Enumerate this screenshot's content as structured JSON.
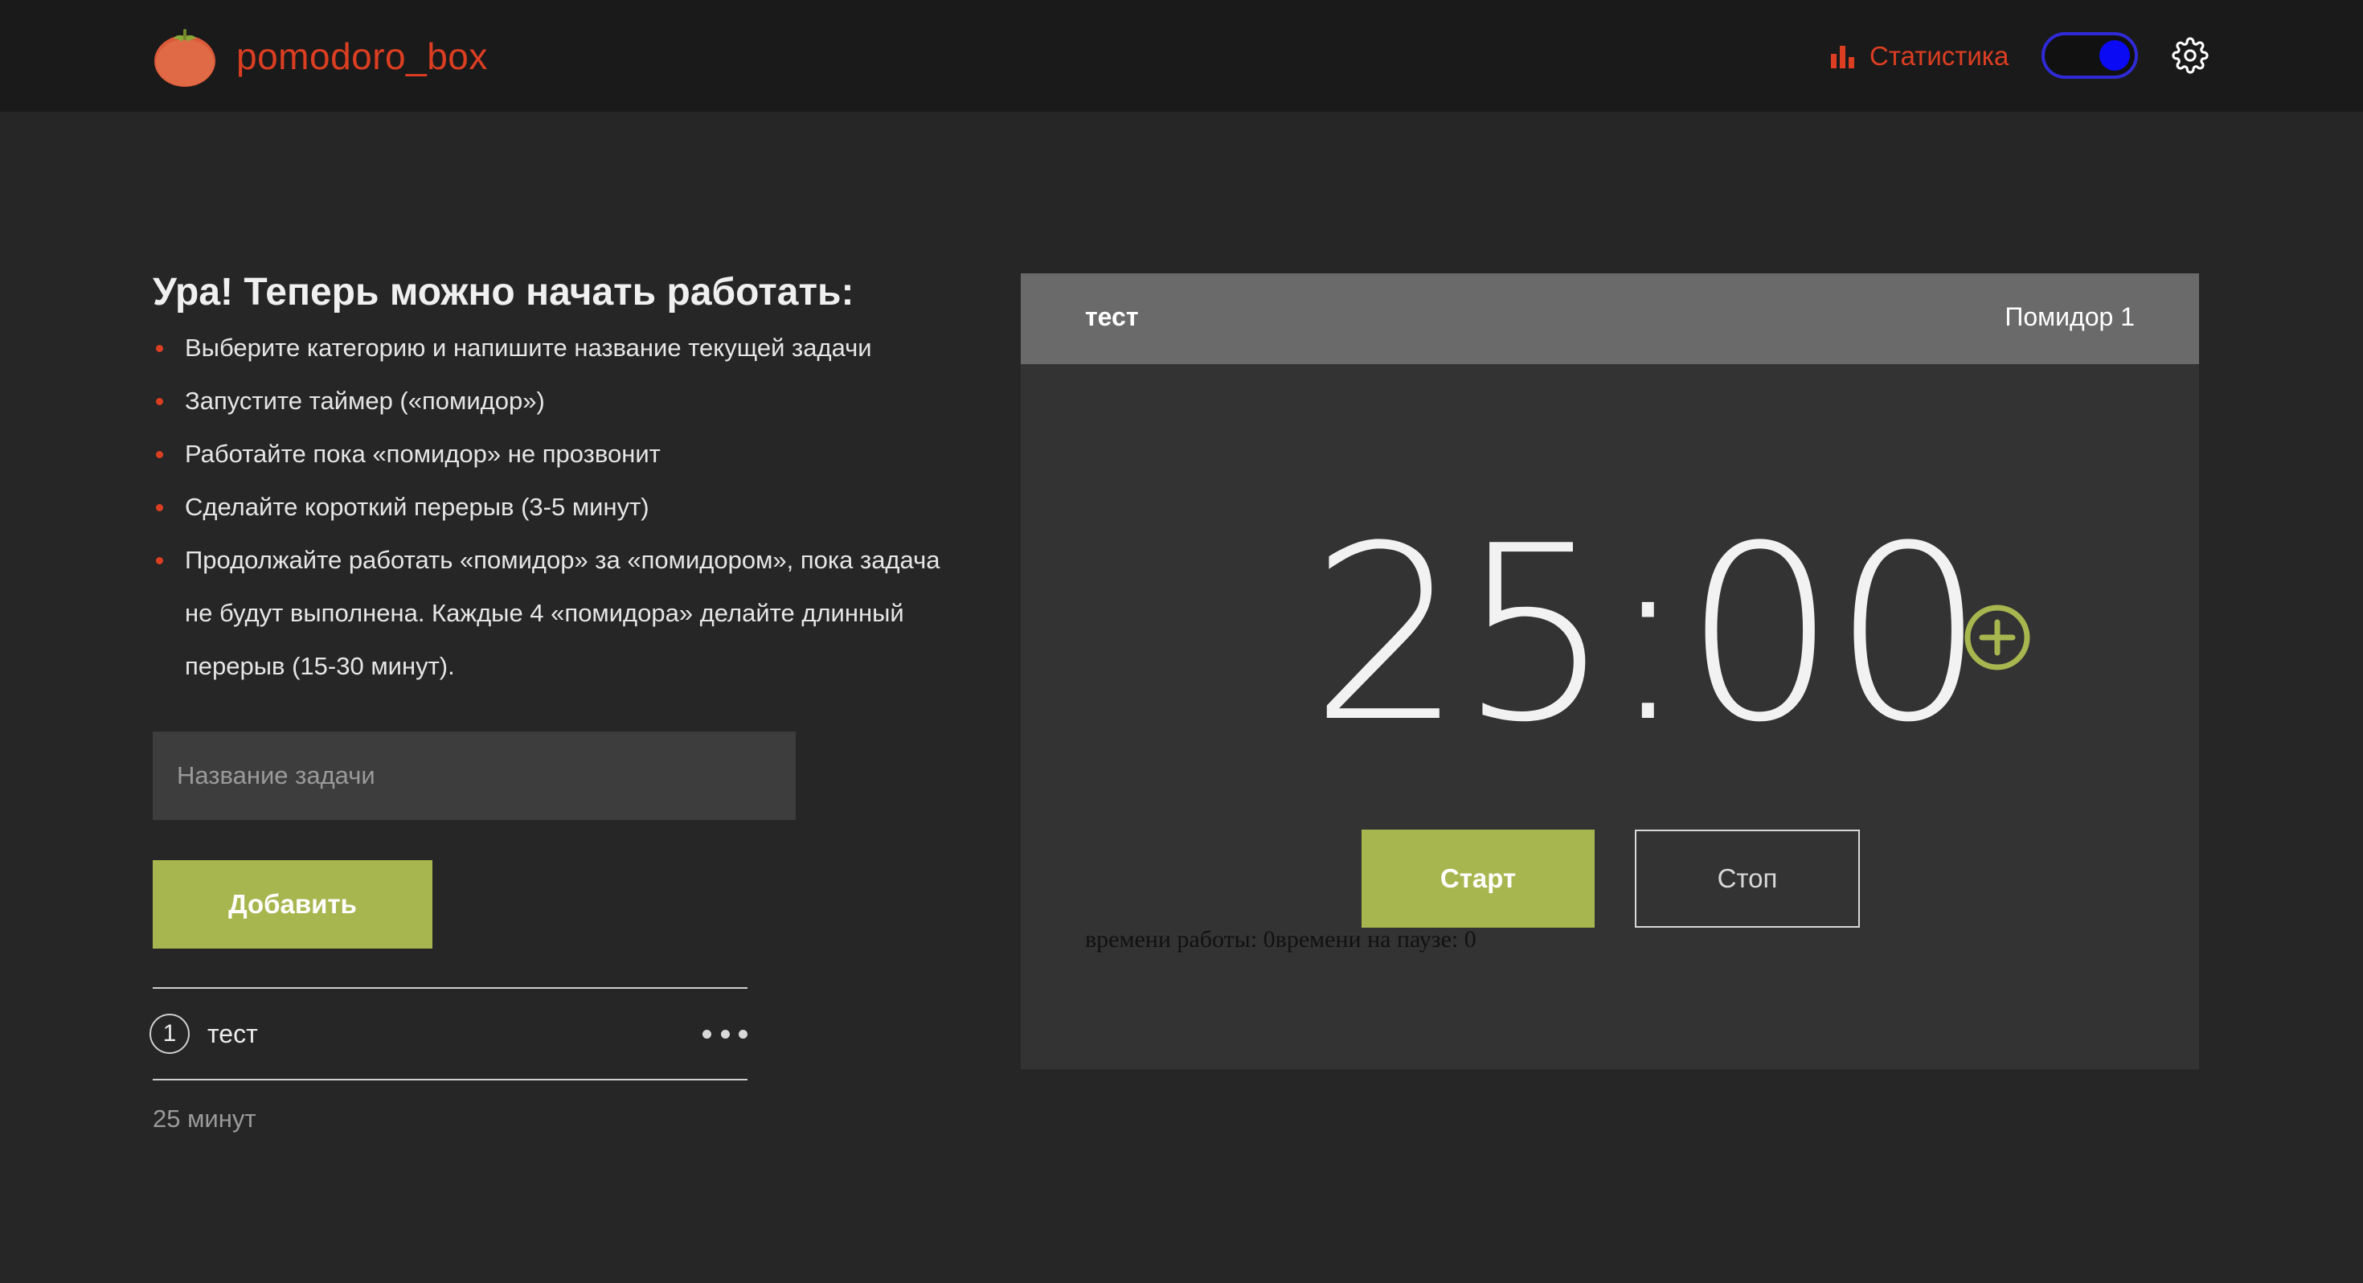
{
  "header": {
    "logo_text": "pomodoro_box",
    "logo_icon": "tomato-icon",
    "stats_label": "Статистика",
    "stats_icon": "bar-chart-icon",
    "settings_icon": "gear-icon",
    "theme_toggle_state": "on",
    "colors": {
      "brand": "#dc3e22",
      "toggle_border": "#2f2ad6",
      "toggle_knob": "#0a0af5"
    }
  },
  "intro": {
    "title": "Ура! Теперь можно начать работать:",
    "steps": [
      "Выберите категорию и напишите название текущей задачи",
      "Запустите таймер («помидор»)",
      "Работайте пока «помидор» не прозвонит",
      "Сделайте короткий перерыв (3-5 минут)",
      "Продолжайте работать «помидор» за «помидором», пока задача не будут выполнена. Каждые 4 «помидора» делайте длинный перерыв (15-30 минут)."
    ]
  },
  "task_form": {
    "placeholder": "Название задачи",
    "value": "",
    "add_label": "Добавить",
    "add_color": "#a8b64f"
  },
  "tasks": [
    {
      "count": "1",
      "name": "тест",
      "menu_icon": "more-dots-icon"
    }
  ],
  "total_time": "25 минут",
  "timer": {
    "task_name": "тест",
    "pomodoro_label": "Помидор 1",
    "time": "25:00",
    "add_time_icon": "plus-circle-icon",
    "start_label": "Старт",
    "stop_label": "Стоп",
    "stats_text": "времени работы: 0времени на паузе: 0",
    "colors": {
      "header_bg": "#6a6a6a",
      "body_bg": "#333333",
      "accent": "#a8b64f"
    }
  }
}
